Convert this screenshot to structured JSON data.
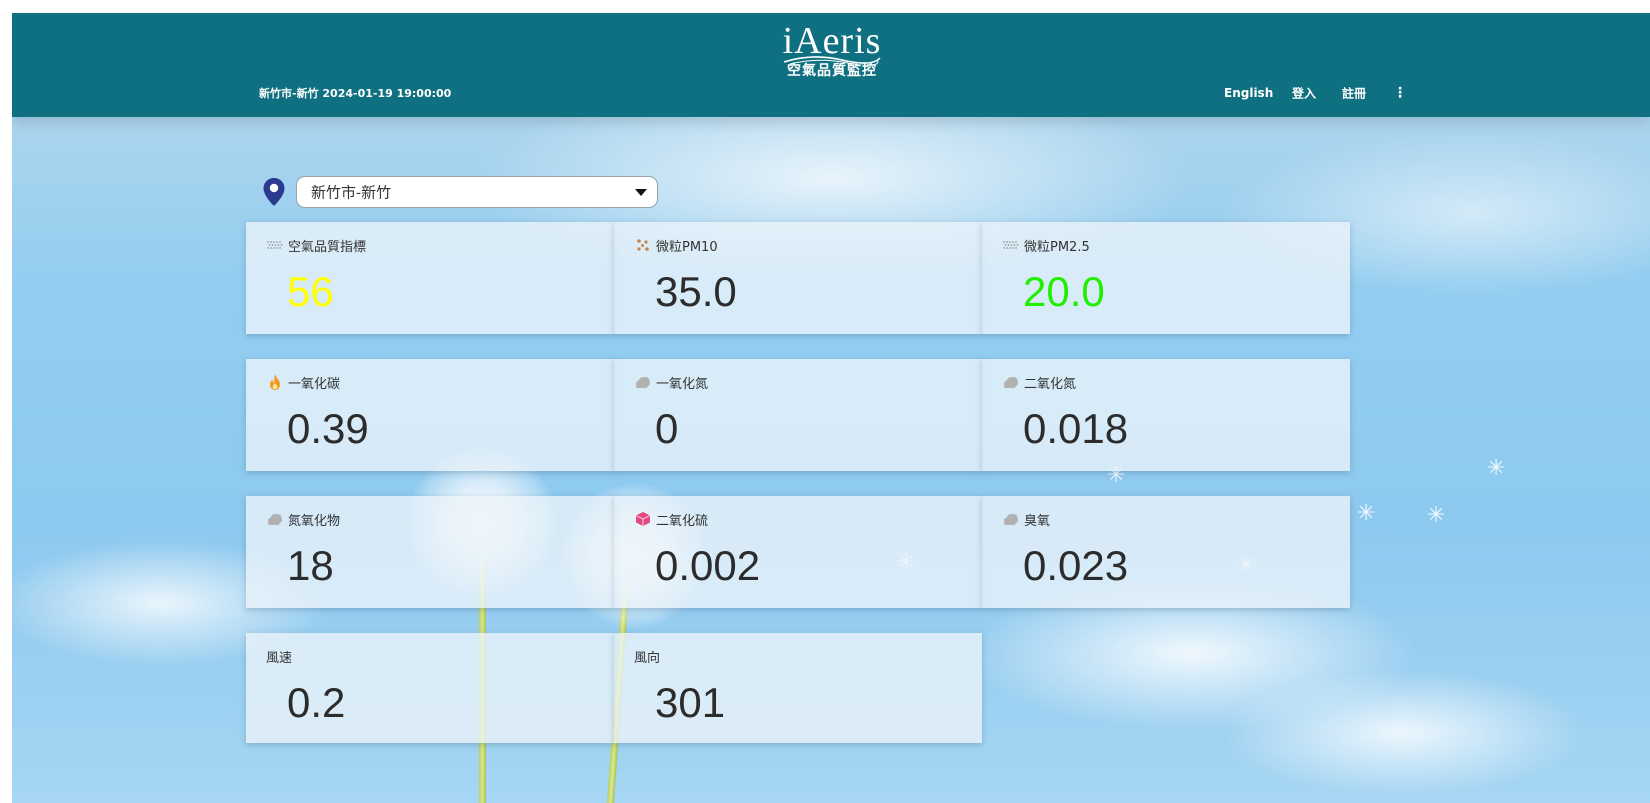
{
  "header": {
    "station_time": "新竹市-新竹 2024-01-19 19:00:00",
    "logo_word": "iAeris",
    "logo_subtitle": "空氣品質監控",
    "nav": {
      "english": "English",
      "login": "登入",
      "register": "註冊",
      "more": "⋮"
    },
    "background_color": "#0f7081"
  },
  "location": {
    "selected": "新竹市-新竹",
    "pin_color": "#2b3a8f"
  },
  "cards": [
    {
      "label": "空氣品質指標",
      "value": "56",
      "icon": "dots-icon",
      "value_color": "#ffff00"
    },
    {
      "label": "微粒PM10",
      "value": "35.0",
      "icon": "particles-icon",
      "value_color": "#2c2c2c"
    },
    {
      "label": "微粒PM2.5",
      "value": "20.0",
      "icon": "dots-icon",
      "value_color": "#22ee00"
    },
    {
      "label": "一氧化碳",
      "value": "0.39",
      "icon": "flame-icon",
      "value_color": "#2c2c2c"
    },
    {
      "label": "一氧化氮",
      "value": "0",
      "icon": "gas-cloud-icon",
      "value_color": "#2c2c2c"
    },
    {
      "label": "二氧化氮",
      "value": "0.018",
      "icon": "gas-cloud-icon",
      "value_color": "#2c2c2c"
    },
    {
      "label": "氮氧化物",
      "value": "18",
      "icon": "gas-cloud-icon",
      "value_color": "#2c2c2c"
    },
    {
      "label": "二氧化硫",
      "value": "0.002",
      "icon": "cube-icon",
      "value_color": "#2c2c2c"
    },
    {
      "label": "臭氧",
      "value": "0.023",
      "icon": "gas-cloud-icon",
      "value_color": "#2c2c2c"
    },
    {
      "label": "風速",
      "value": "0.2",
      "icon": "",
      "value_color": "#2c2c2c"
    },
    {
      "label": "風向",
      "value": "301",
      "icon": "",
      "value_color": "#2c2c2c"
    }
  ]
}
